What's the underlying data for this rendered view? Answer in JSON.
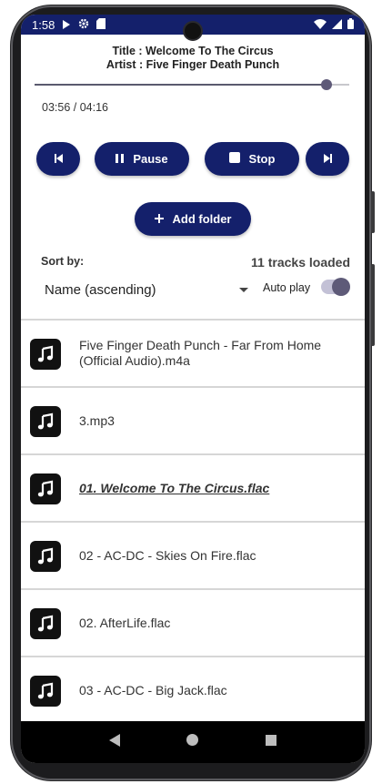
{
  "status_bar": {
    "time": "1:58",
    "icons": [
      "play-icon",
      "gear-icon",
      "sd-card-icon"
    ],
    "right_icons": [
      "wifi-icon",
      "signal-icon",
      "battery-icon"
    ]
  },
  "now_playing": {
    "title_line": "Title : Welcome To The Circus",
    "artist_line": "Artist : Five Finger Death Punch",
    "progress": 0.927,
    "time_text": "03:56 / 04:16"
  },
  "controls": {
    "previous": {
      "icon": "skip-previous-icon"
    },
    "pause": {
      "label": "Pause",
      "icon": "pause-icon"
    },
    "stop": {
      "label": "Stop",
      "icon": "stop-icon"
    },
    "next": {
      "icon": "skip-next-icon"
    }
  },
  "add_folder": {
    "label": "Add folder",
    "icon": "plus-icon"
  },
  "sort": {
    "label": "Sort by:",
    "selected": "Name (ascending)"
  },
  "tracks_loaded": "11 tracks loaded",
  "autoplay": {
    "label": "Auto play",
    "enabled": true
  },
  "tracks": [
    {
      "name": "Five Finger Death Punch - Far From Home (Official Audio).m4a",
      "current": false
    },
    {
      "name": "3.mp3",
      "current": false
    },
    {
      "name": "01. Welcome To The Circus.flac",
      "current": true
    },
    {
      "name": "02 - AC-DC - Skies On Fire.flac",
      "current": false
    },
    {
      "name": "02. AfterLife.flac",
      "current": false
    },
    {
      "name": "03 - AC-DC - Big Jack.flac",
      "current": false
    }
  ],
  "colors": {
    "primary": "#14206b",
    "accent": "#5e5a78"
  }
}
